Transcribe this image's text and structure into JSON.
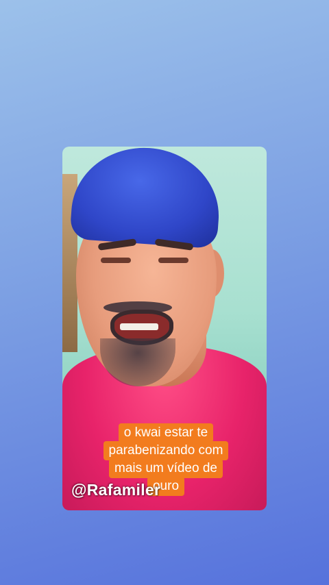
{
  "story": {
    "caption_lines": [
      "o kwai estar te",
      "parabenizando com",
      "mais um vídeo de",
      "ouro"
    ],
    "watermark": "@Rafamiler"
  },
  "colors": {
    "background_top": "#9cc1ea",
    "background_bottom": "#5672dc",
    "caption_bg": "#f27c1e",
    "cap": "#2f46c8",
    "shirt": "#e8236a"
  }
}
